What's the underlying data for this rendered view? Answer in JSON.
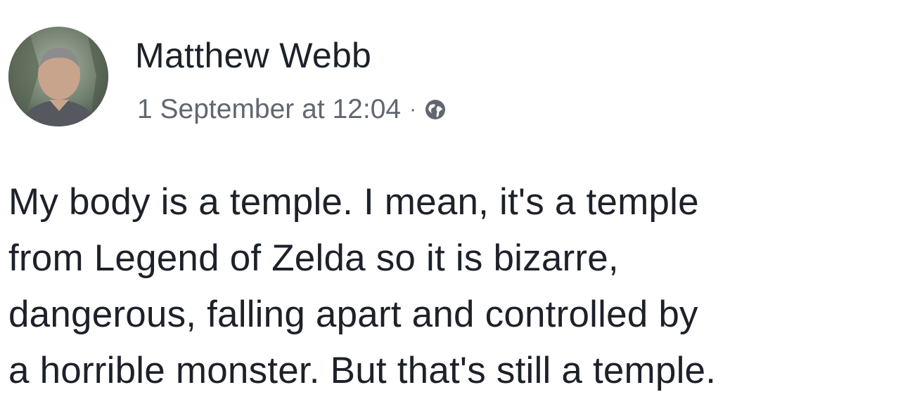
{
  "post": {
    "author": "Matthew Webb",
    "timestamp": "1 September at 12:04",
    "separator": "·",
    "privacy_icon": "globe-icon",
    "avatar_icon": "profile-photo",
    "text_lines": [
      "My body is a temple. I mean, it's a temple",
      "from Legend of Zelda so it is bizarre,",
      "dangerous, falling apart and controlled by",
      "a horrible monster. But that's still a temple."
    ]
  },
  "colors": {
    "text": "#1d2129",
    "meta": "#606770",
    "background": "#ffffff"
  }
}
